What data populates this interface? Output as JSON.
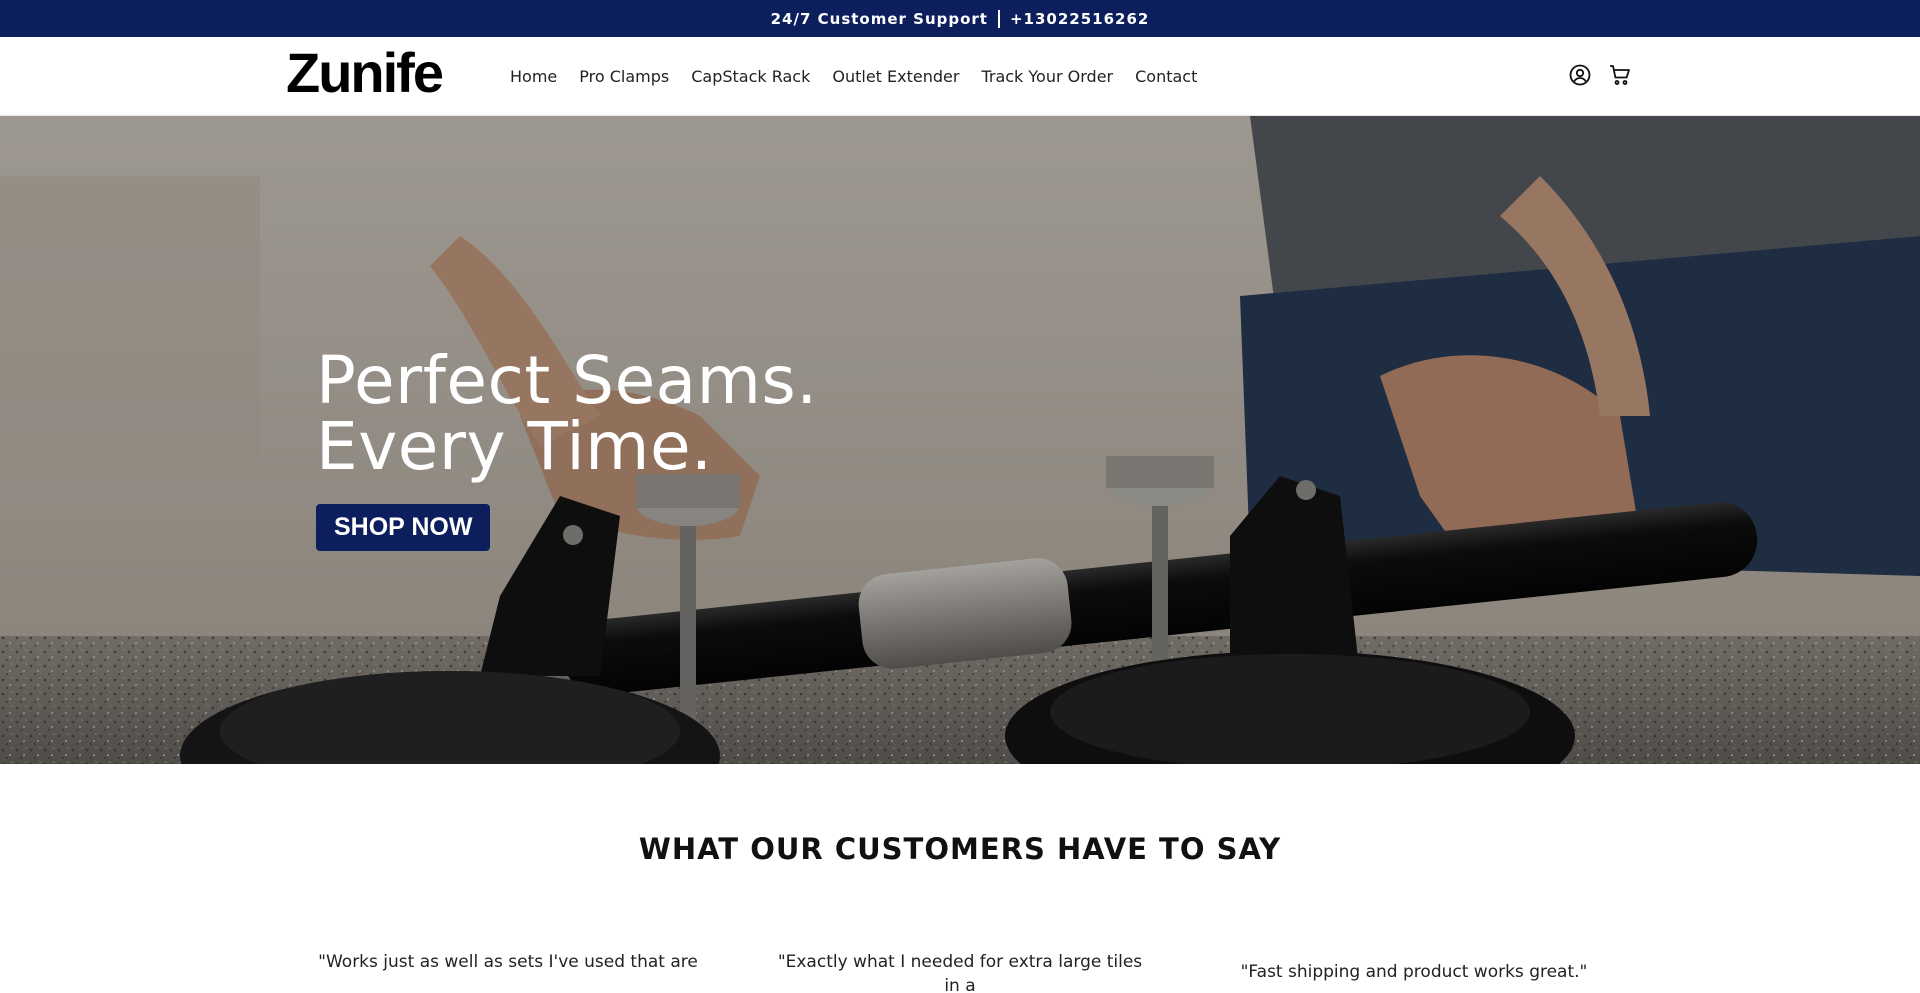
{
  "announcement": {
    "support_label": "24/7 Customer Support",
    "phone": "+13022516262"
  },
  "header": {
    "logo": "Zunife",
    "nav": [
      "Home",
      "Pro Clamps",
      "CapStack Rack",
      "Outlet Extender",
      "Track Your Order",
      "Contact"
    ],
    "icons": [
      "account-icon",
      "cart-icon"
    ]
  },
  "hero": {
    "title_line1": "Perfect Seams.",
    "title_line2": "Every Time.",
    "cta": "SHOP NOW"
  },
  "reviews": {
    "title": "WHAT OUR CUSTOMERS HAVE TO SAY",
    "items": [
      {
        "quote": "\"Works just as well as sets I've used that are"
      },
      {
        "quote": "\"Exactly what I needed for extra large tiles in a"
      },
      {
        "quote": "\"Fast shipping and product works great.\""
      }
    ]
  },
  "colors": {
    "brand_navy": "#0c1f5c",
    "text": "#111111",
    "background": "#ffffff"
  }
}
